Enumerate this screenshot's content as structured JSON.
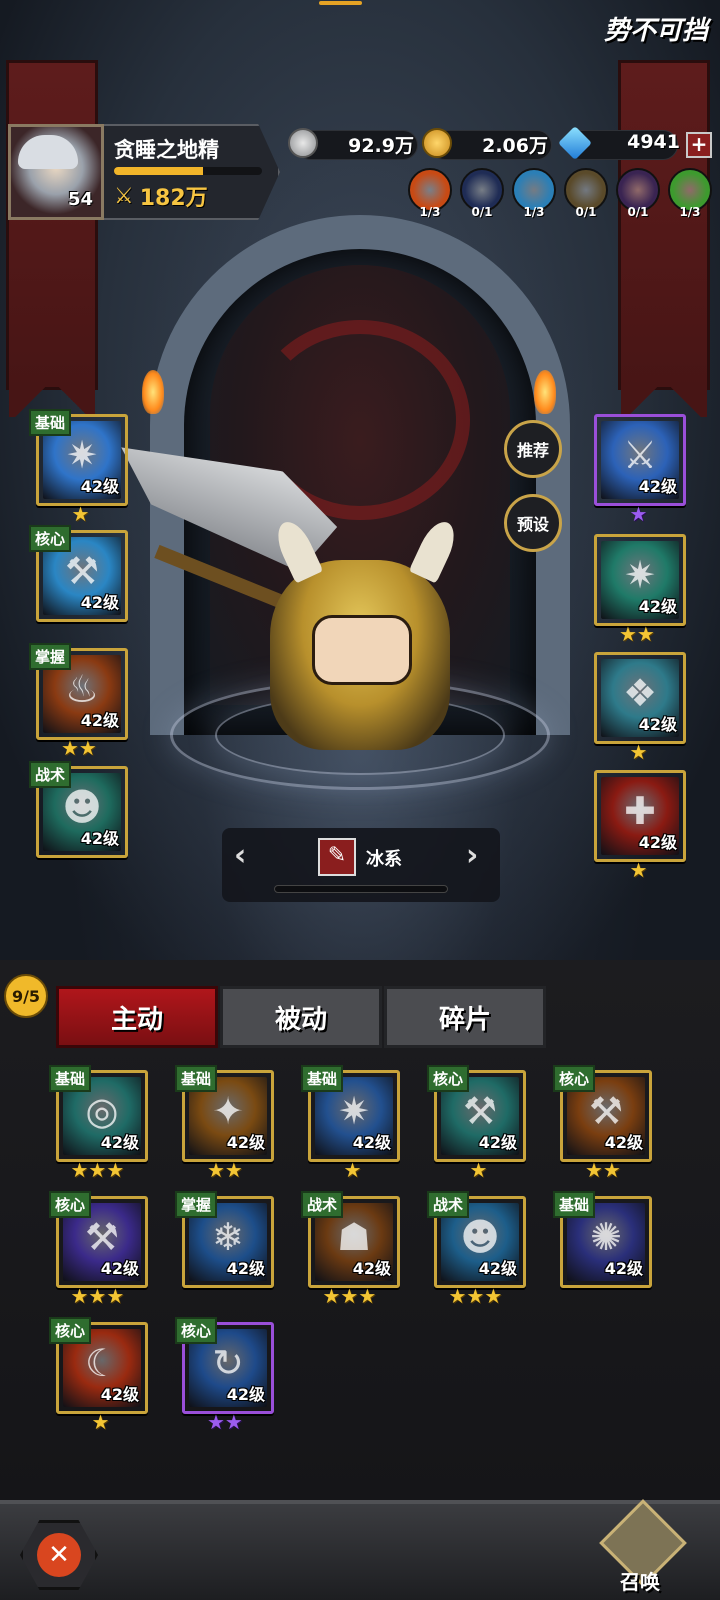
{
  "header": {
    "title": "势不可挡"
  },
  "player": {
    "name": "贪睡之地精",
    "level": "54",
    "power": "182万",
    "exp_fraction": 0.6
  },
  "currencies": [
    {
      "icon": "silver-coin-icon",
      "value": "92.9万"
    },
    {
      "icon": "gold-coin-icon",
      "value": "2.06万"
    },
    {
      "icon": "diamond-icon",
      "value": "4941"
    }
  ],
  "elements": [
    {
      "icon": "fire-element-icon",
      "count": "1/3",
      "color": "#c84a14"
    },
    {
      "icon": "dark-element-icon",
      "count": "0/1",
      "color": "#1f2c55"
    },
    {
      "icon": "ice-element-icon",
      "count": "1/3",
      "color": "#2b7fb6"
    },
    {
      "icon": "earth-element-icon",
      "count": "0/1",
      "color": "#5a4a2a"
    },
    {
      "icon": "shadow-element-icon",
      "count": "0/1",
      "color": "#3a2452"
    },
    {
      "icon": "nature-element-icon",
      "count": "1/3",
      "color": "#3d9a2e"
    }
  ],
  "side_buttons": {
    "recommend": "推荐",
    "preset": "预设"
  },
  "left_slots": [
    {
      "tag": "基础",
      "level": "42级",
      "stars": "★",
      "color": "#2f74c9",
      "border": "gold",
      "glyph": "✷"
    },
    {
      "tag": "核心",
      "level": "42级",
      "stars": "",
      "color": "#2a86c4",
      "border": "gold",
      "glyph": "⚒"
    },
    {
      "tag": "掌握",
      "level": "42级",
      "stars": "★★",
      "color": "#8a3a12",
      "border": "gold",
      "glyph": "♨"
    },
    {
      "tag": "战术",
      "level": "42级",
      "stars": "",
      "color": "#1e6b5e",
      "border": "gold",
      "glyph": "☻"
    }
  ],
  "right_slots": [
    {
      "level": "42级",
      "stars": "★",
      "color": "#2c62b8",
      "border": "purple",
      "glyph": "⚔"
    },
    {
      "level": "42级",
      "stars": "★★",
      "color": "#1f7a68",
      "border": "gold",
      "glyph": "✷"
    },
    {
      "level": "42级",
      "stars": "★",
      "color": "#2e7a8a",
      "border": "gold",
      "glyph": "❖"
    },
    {
      "level": "42级",
      "stars": "★",
      "color": "#8a1a12",
      "border": "gold",
      "glyph": "✚"
    }
  ],
  "selector": {
    "label": "冰系",
    "progress": 0.25
  },
  "skill_count": "9/5",
  "tabs": [
    {
      "label": "主动"
    },
    {
      "label": "被动"
    },
    {
      "label": "碎片"
    }
  ],
  "skills": [
    {
      "tag": "基础",
      "level": "42级",
      "stars": "★★★",
      "color": "#1f6b66",
      "border": "gold",
      "glyph": "◎"
    },
    {
      "tag": "基础",
      "level": "42级",
      "stars": "★★",
      "color": "#7a4a12",
      "border": "gold",
      "glyph": "✦"
    },
    {
      "tag": "基础",
      "level": "42级",
      "stars": "★",
      "color": "#22508f",
      "border": "gold",
      "glyph": "✷"
    },
    {
      "tag": "核心",
      "level": "42级",
      "stars": "★",
      "color": "#1f6b66",
      "border": "gold",
      "glyph": "⚒"
    },
    {
      "tag": "核心",
      "level": "42级",
      "stars": "★★",
      "color": "#7a3e10",
      "border": "gold",
      "glyph": "⚒"
    },
    {
      "tag": "核心",
      "level": "42级",
      "stars": "★★★",
      "color": "#3b2a8a",
      "border": "gold",
      "glyph": "⚒"
    },
    {
      "tag": "掌握",
      "level": "42级",
      "stars": "",
      "color": "#1d4e8a",
      "border": "gold",
      "glyph": "❄"
    },
    {
      "tag": "战术",
      "level": "42级",
      "stars": "★★★",
      "color": "#6b3a12",
      "border": "gold",
      "glyph": "☗"
    },
    {
      "tag": "战术",
      "level": "42级",
      "stars": "★★★",
      "color": "#1d5e8a",
      "border": "gold",
      "glyph": "☻"
    },
    {
      "tag": "基础",
      "level": "42级",
      "stars": "",
      "color": "#2a2f7a",
      "border": "gold",
      "glyph": "✺"
    },
    {
      "tag": "核心",
      "level": "42级",
      "stars": "★",
      "color": "#9a2a10",
      "border": "gold",
      "glyph": "☾"
    },
    {
      "tag": "核心",
      "level": "42级",
      "stars": "★★",
      "color": "#1e4a8a",
      "border": "purple",
      "glyph": "↻"
    }
  ],
  "bottom": {
    "close_icon": "close-icon",
    "summon_label": "召唤"
  }
}
